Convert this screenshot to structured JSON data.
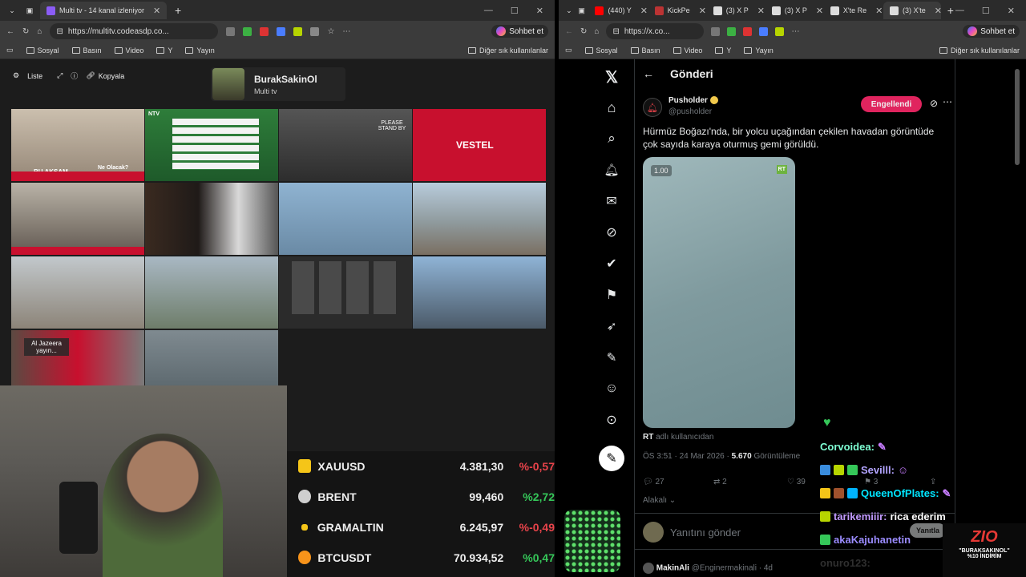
{
  "left_browser": {
    "tab_title": "Multi tv - 14 kanal izleniyor",
    "url": "https://multitv.codeasdp.co...",
    "copilot_label": "Sohbet et",
    "bookmarks": [
      "Sosyal",
      "Basın",
      "Video",
      "Y",
      "Yayın"
    ],
    "other_bookmarks": "Diğer sık kullanılanlar"
  },
  "multitv": {
    "toolbar": {
      "list_label": "Liste",
      "copy_label": "Kopyala"
    },
    "channel": {
      "name": "BurakSakinOl",
      "subtitle": "Multi tv"
    },
    "tile_texts": {
      "bu_aksam": "BU AKŞAM",
      "ne_olacak": "Ne Olacak?",
      "ntv": "NTV",
      "stand_by": "PLEASE STAND BY",
      "vestel": "VESTEL",
      "traffic_bar": "TRAFİKTE CEZA SİSTEMİ ACİL Mİ?",
      "al_jazeera": "Al Jazeera yayın..."
    }
  },
  "ticker": [
    {
      "name": "XAUUSD",
      "value": "4.381,30",
      "change": "%-0,57",
      "direction": "down",
      "icon_color": "#f5c518"
    },
    {
      "name": "BRENT",
      "value": "99,460",
      "change": "%2,72",
      "direction": "up",
      "icon_color": "#cfcfcf"
    },
    {
      "name": "GRAMALTIN",
      "value": "6.245,97",
      "change": "%-0,49",
      "direction": "down",
      "icon_color": "#f5c518"
    },
    {
      "name": "BTCUSDT",
      "value": "70.934,52",
      "change": "%0,47",
      "direction": "up",
      "icon_color": "#f7931a"
    }
  ],
  "right_browser": {
    "tabs": [
      "(440) Y",
      "KickPe",
      "(3) X P",
      "(3) X P",
      "X'te Re",
      "(3) X'te"
    ],
    "url": "https://x.co...",
    "copilot_label": "Sohbet et",
    "bookmarks": [
      "Sosyal",
      "Basın",
      "Video",
      "Y",
      "Yayın"
    ],
    "other_bookmarks": "Diğer sık kullanılanlar"
  },
  "x": {
    "header": "Gönderi",
    "author": {
      "name": "Pusholder",
      "handle": "@pusholder"
    },
    "blocked_label": "Engellendi",
    "text": "Hürmüz Boğazı'nda, bir yolcu uçağından çekilen havadan görüntüde çok sayıda karaya oturmuş gemi görüldü.",
    "video_time": "1.00",
    "video_badge": "RT",
    "source_user": "RT",
    "source_suffix": "adlı kullanıcıdan",
    "timestamp": "ÖS 3:51 · 24 Mar 2026 ·",
    "views": "5.670",
    "views_label": "Görüntüleme",
    "replies": "27",
    "reposts": "2",
    "likes": "39",
    "bookmarks_count": "3",
    "sort_label": "Alakalı",
    "reply_placeholder": "Yanıtını gönder",
    "reply_button": "Yanıtla",
    "next_reply": {
      "name": "MakinAli",
      "handle": "@Enginermakinali · 4d"
    }
  },
  "chat": [
    {
      "user": "Corvoidea:",
      "msg": "",
      "color": "#7fffd4"
    },
    {
      "user": "Sevilll:",
      "msg": "",
      "color": "#b3a4ff"
    },
    {
      "user": "QueenOfPlates:",
      "msg": "",
      "color": "#00e5ff"
    },
    {
      "user": "tarikemiiir:",
      "msg": "rica ederim",
      "color": "#c29bff"
    },
    {
      "user": "akaKajuhanetin",
      "msg": "",
      "color": "#9b8cff"
    },
    {
      "user": "onuro123:",
      "msg": "",
      "color": "#888888"
    }
  ],
  "overlay_logo": {
    "brand": "ZIO",
    "line1": "\"BURAKSAKINOL\"",
    "line2": "%10 İNDİRİM"
  }
}
